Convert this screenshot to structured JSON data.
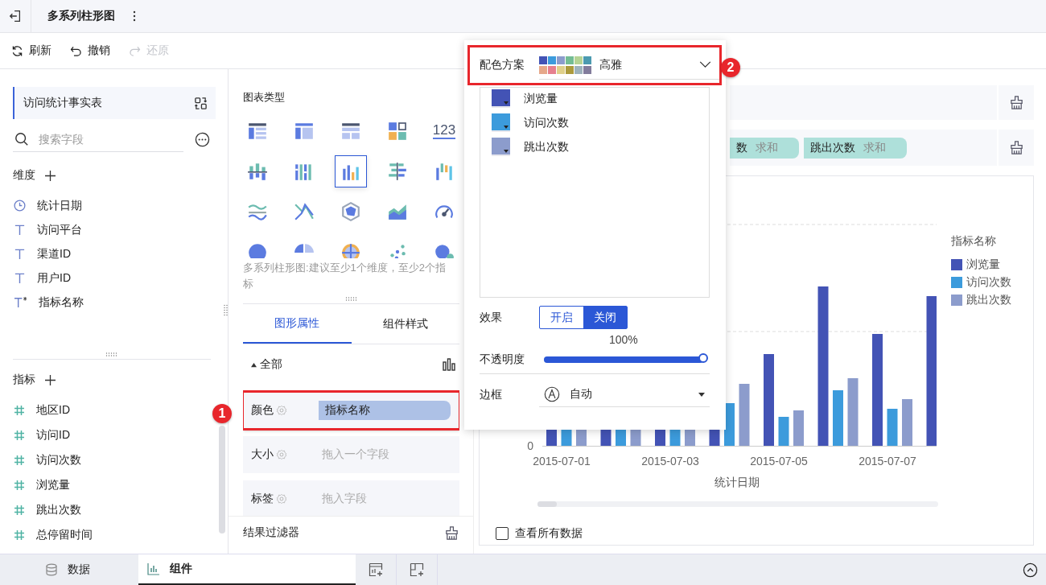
{
  "header": {
    "title": "多系列柱形图"
  },
  "toolbar": [
    {
      "label": "刷新",
      "disabled": false
    },
    {
      "label": "撤销",
      "disabled": false
    },
    {
      "label": "还原",
      "disabled": true
    }
  ],
  "dataset": {
    "name": "访问统计事实表"
  },
  "search": {
    "placeholder": "搜索字段"
  },
  "dimensions": {
    "title": "维度",
    "fields": [
      {
        "name": "统计日期",
        "kind": "date"
      },
      {
        "name": "访问平台",
        "kind": "text"
      },
      {
        "name": "渠道ID",
        "kind": "text"
      },
      {
        "name": "用户ID",
        "kind": "text"
      },
      {
        "name": "指标名称",
        "kind": "text-star"
      }
    ]
  },
  "measures": {
    "title": "指标",
    "fields": [
      {
        "name": "地区ID"
      },
      {
        "name": "访问ID"
      },
      {
        "name": "访问次数"
      },
      {
        "name": "浏览量"
      },
      {
        "name": "跳出次数"
      },
      {
        "name": "总停留时间"
      }
    ]
  },
  "chart_types": {
    "title": "图表类型",
    "hint": "多系列柱形图:建议至少1个维度，至少2个指标",
    "items": [
      {
        "selected": false
      },
      {
        "selected": false
      },
      {
        "selected": false
      },
      {
        "selected": false
      },
      {
        "selected": false,
        "label": "123"
      },
      {
        "selected": false
      },
      {
        "selected": false
      },
      {
        "selected": true
      },
      {
        "selected": false
      },
      {
        "selected": false
      },
      {
        "selected": false
      },
      {
        "selected": false
      },
      {
        "selected": false
      },
      {
        "selected": false
      },
      {
        "selected": false
      },
      {
        "selected": false
      },
      {
        "selected": false
      },
      {
        "selected": false
      },
      {
        "selected": false
      },
      {
        "selected": false
      }
    ]
  },
  "property_tabs": [
    {
      "label": "图形属性",
      "selected": true
    },
    {
      "label": "组件样式",
      "selected": false
    }
  ],
  "section": {
    "label": "全部"
  },
  "properties": [
    {
      "label": "颜色",
      "value": "指标名称",
      "highlighted": true
    },
    {
      "label": "大小",
      "placeholder": "拖入一个字段",
      "highlighted": false
    },
    {
      "label": "标签",
      "placeholder": "拖入字段",
      "highlighted": false
    }
  ],
  "result_filter": {
    "label": "结果过滤器"
  },
  "value_chips": [
    {
      "field": "数",
      "aggregation": "求和"
    },
    {
      "field": "跳出次数",
      "aggregation": "求和"
    }
  ],
  "chart": {
    "y_tick": "0",
    "categories": [
      "2015-07-01",
      "2015-07-03",
      "2015-07-05",
      "2015-07-07"
    ],
    "xlabel": "统计日期",
    "legend_title": "指标名称",
    "legend": [
      {
        "name": "浏览量",
        "color": "#4353b5"
      },
      {
        "name": "访问次数",
        "color": "#3c9bdc"
      },
      {
        "name": "跳出次数",
        "color": "#8c9ccc"
      }
    ]
  },
  "view_all": {
    "label": "查看所有数据",
    "checked": false
  },
  "color_panel": {
    "label": "配色方案",
    "highlighted": true,
    "palette": [
      {
        "color": "#4353b5"
      },
      {
        "color": "#3c9bdc"
      },
      {
        "color": "#8c9ccc"
      },
      {
        "color": "#74bd94"
      },
      {
        "color": "#b5d394"
      },
      {
        "color": "#4c9ab0"
      },
      {
        "color": "#e6a88a"
      },
      {
        "color": "#e6808e"
      },
      {
        "color": "#e0d08a"
      },
      {
        "color": "#ac9a3c"
      },
      {
        "color": "#9eb2bc"
      },
      {
        "color": "#827c9c"
      }
    ],
    "scheme": "高雅",
    "series": [
      {
        "name": "浏览量",
        "color": "#4353b5"
      },
      {
        "name": "访问次数",
        "color": "#3c9bdc"
      },
      {
        "name": "跳出次数",
        "color": "#8c9ccc"
      }
    ],
    "effect": {
      "label": "效果",
      "options": [
        {
          "label": "开启",
          "selected": false
        },
        {
          "label": "关闭",
          "selected": true
        }
      ]
    },
    "opacity": {
      "reading": "100%",
      "label": "不透明度",
      "level": 1
    },
    "border": {
      "label": "边框",
      "value": "自动"
    }
  },
  "callouts": [
    {
      "number": "1"
    },
    {
      "number": "2"
    }
  ],
  "bottom_tabs": [
    {
      "label": "数据",
      "selected": false
    },
    {
      "label": "组件",
      "selected": true
    }
  ]
}
